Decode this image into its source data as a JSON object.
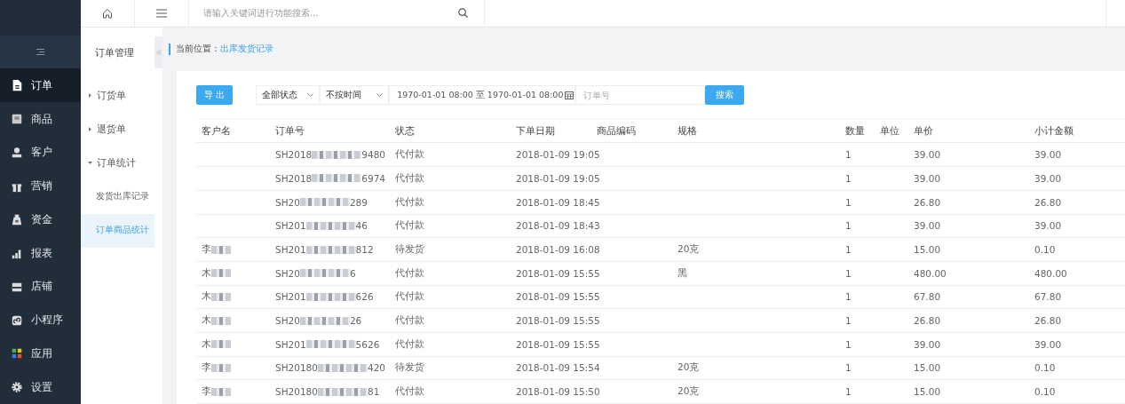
{
  "topbar": {
    "search": {
      "placeholder": "请输入关键词进行功能搜索..."
    }
  },
  "nav": {
    "items": [
      {
        "label": "订单",
        "selected": true
      },
      {
        "label": "商品",
        "selected": false
      },
      {
        "label": "客户",
        "selected": false
      },
      {
        "label": "营销",
        "selected": false
      },
      {
        "label": "资金",
        "selected": false
      },
      {
        "label": "报表",
        "selected": false
      },
      {
        "label": "店铺",
        "selected": false
      },
      {
        "label": "小程序",
        "selected": false
      },
      {
        "label": "应用",
        "selected": false
      },
      {
        "label": "设置",
        "selected": false
      }
    ]
  },
  "subnav": {
    "title": "订单管理",
    "items": [
      {
        "label": "订货单",
        "expanded": false
      },
      {
        "label": "退货单",
        "expanded": false
      },
      {
        "label": "订单统计",
        "expanded": true,
        "children": [
          {
            "label": "发货出库记录",
            "selected": false
          },
          {
            "label": "订单商品统计",
            "selected": true
          }
        ]
      }
    ]
  },
  "breadcrumb": {
    "label": "当前位置：",
    "current": "出库发货记录"
  },
  "toolbar": {
    "export_button": "导 出",
    "status_select": "全部状态",
    "time_select": "不按时间",
    "date_range": "1970-01-01 08:00 至 1970-01-01 08:00",
    "order_field": {
      "placeholder": "订单号"
    },
    "search_button": "搜索"
  },
  "table": {
    "columns": [
      "客户名",
      "订单号",
      "状态",
      "下单日期",
      "商品编码",
      "规格",
      "数量",
      "单位",
      "单价",
      "小计金额"
    ],
    "rows": [
      {
        "customer": "",
        "order_prefix": "SH2018",
        "order_suffix": "9480",
        "status": "代付款",
        "date": "2018-01-09 19:05",
        "spec": "",
        "qty": "1",
        "price": "39.00",
        "subtotal": "39.00"
      },
      {
        "customer": "",
        "order_prefix": "SH2018",
        "order_suffix": "6974",
        "status": "代付款",
        "date": "2018-01-09 19:05",
        "spec": "",
        "qty": "1",
        "price": "39.00",
        "subtotal": "39.00"
      },
      {
        "customer": "",
        "order_prefix": "SH20",
        "order_suffix": "289",
        "status": "代付款",
        "date": "2018-01-09 18:45",
        "spec": "",
        "qty": "1",
        "price": "26.80",
        "subtotal": "26.80"
      },
      {
        "customer": "",
        "order_prefix": "SH201",
        "order_suffix": "46",
        "status": "代付款",
        "date": "2018-01-09 18:43",
        "spec": "",
        "qty": "1",
        "price": "39.00",
        "subtotal": "39.00"
      },
      {
        "customer": "李",
        "order_prefix": "SH201",
        "order_suffix": "812",
        "status": "待发货",
        "date": "2018-01-09 16:08",
        "spec": "20克",
        "qty": "1",
        "price": "15.00",
        "subtotal": "0.10"
      },
      {
        "customer": "木",
        "order_prefix": "SH20",
        "order_suffix": "6",
        "status": "代付款",
        "date": "2018-01-09 15:55",
        "spec": "黑",
        "qty": "1",
        "price": "480.00",
        "subtotal": "480.00"
      },
      {
        "customer": "木",
        "order_prefix": "SH201",
        "order_suffix": "626",
        "status": "代付款",
        "date": "2018-01-09 15:55",
        "spec": "",
        "qty": "1",
        "price": "67.80",
        "subtotal": "67.80"
      },
      {
        "customer": "木",
        "order_prefix": "SH20",
        "order_suffix": "26",
        "status": "代付款",
        "date": "2018-01-09 15:55",
        "spec": "",
        "qty": "1",
        "price": "26.80",
        "subtotal": "26.80"
      },
      {
        "customer": "木",
        "order_prefix": "SH201",
        "order_suffix": "5626",
        "status": "代付款",
        "date": "2018-01-09 15:55",
        "spec": "",
        "qty": "1",
        "price": "39.00",
        "subtotal": "39.00"
      },
      {
        "customer": "李",
        "order_prefix": "SH20180",
        "order_suffix": "420",
        "status": "待发货",
        "date": "2018-01-09 15:54",
        "spec": "20克",
        "qty": "1",
        "price": "15.00",
        "subtotal": "0.10"
      },
      {
        "customer": "李",
        "order_prefix": "SH20180",
        "order_suffix": "81",
        "status": "代付款",
        "date": "2018-01-09 15:50",
        "spec": "20克",
        "qty": "1",
        "price": "15.00",
        "subtotal": "0.10"
      }
    ]
  }
}
